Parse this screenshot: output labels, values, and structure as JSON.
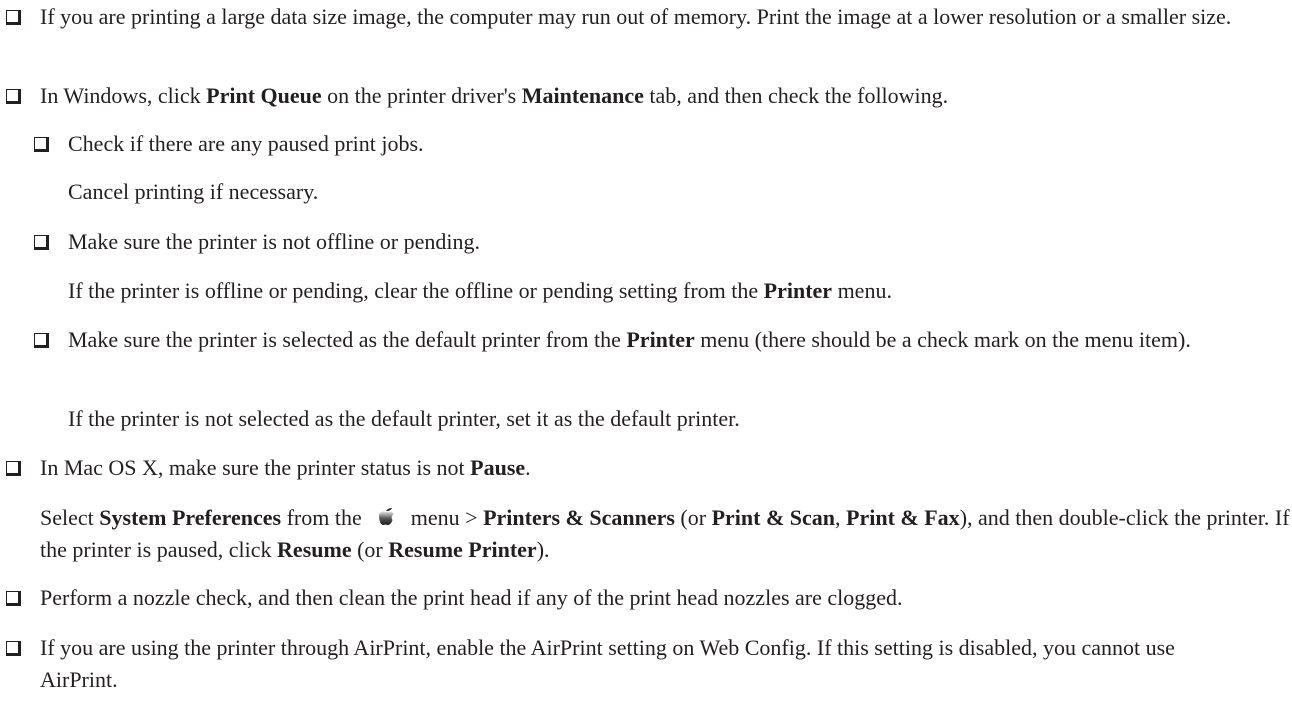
{
  "item1": {
    "text": "If you are printing a large data size image, the computer may run out of memory. Print the image at a lower resolution or a smaller size."
  },
  "item2": {
    "t1": "In Windows, click ",
    "b1": "Print Queue",
    "t2": " on the printer driver's ",
    "b2": "Maintenance",
    "t3": " tab, and then check the following."
  },
  "sub1": {
    "text": "Check if there are any paused print jobs.",
    "note": "Cancel printing if necessary."
  },
  "sub2": {
    "text": "Make sure the printer is not offline or pending.",
    "note_t1": "If the printer is offline or pending, clear the offline or pending setting from the ",
    "note_b1": "Printer",
    "note_t2": " menu."
  },
  "sub3": {
    "t1": "Make sure the printer is selected as the default printer from the ",
    "b1": "Printer",
    "t2": " menu (there should be a check mark on the menu item).",
    "note": "If the printer is not selected as the default printer, set it as the default printer."
  },
  "item3": {
    "t1": "In Mac OS X, make sure the printer status is not ",
    "b1": "Pause",
    "t2": ".",
    "n_t1": "Select ",
    "n_b1": "System Preferences",
    "n_t2": " from the ",
    "n_icon": "apple-menu-icon",
    "n_t3": " menu > ",
    "n_b2": "Printers & Scanners",
    "n_t4": " (or ",
    "n_b3": "Print & Scan",
    "n_t5": ", ",
    "n_b4": "Print & Fax",
    "n_t6": "), and then double-click the printer. If the printer is paused, click ",
    "n_b5": "Resume",
    "n_t7": " (or ",
    "n_b6": "Resume Printer",
    "n_t8": ")."
  },
  "item4": {
    "text": "Perform a nozzle check, and then clean the print head if any of the print head nozzles are clogged."
  },
  "item5": {
    "text": "If you are using the printer through AirPrint, enable the AirPrint setting on Web Config. If this setting is disabled, you cannot use AirPrint."
  }
}
